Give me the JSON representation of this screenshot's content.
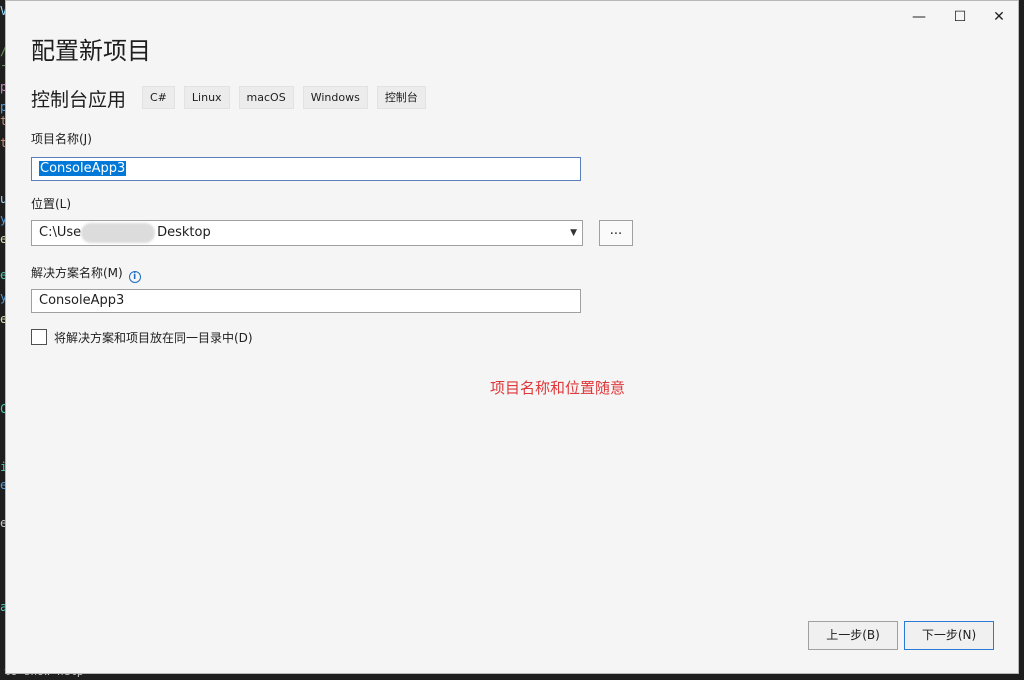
{
  "background": {
    "editor_glyphs": [
      "V",
      "/",
      "-",
      "p",
      "p",
      "t",
      "t",
      "u",
      "y",
      "e",
      "e",
      "y",
      "e",
      "C",
      "i",
      "e",
      "e",
      "a"
    ],
    "footer_text": "to show help"
  },
  "window": {
    "minimize_glyph": "—",
    "maximize_glyph": "☐",
    "close_glyph": "✕"
  },
  "dialog": {
    "title": "配置新项目",
    "template_name": "控制台应用",
    "tags": [
      "C#",
      "Linux",
      "macOS",
      "Windows",
      "控制台"
    ]
  },
  "project_name": {
    "label": "项目名称(J)",
    "value": "ConsoleApp3"
  },
  "location": {
    "label": "位置(L)",
    "value_prefix": "C:\\Use",
    "value_suffix": "Desktop",
    "browse_label": "..."
  },
  "solution_name": {
    "label": "解决方案名称(M)",
    "info_glyph": "i",
    "value": "ConsoleApp3"
  },
  "same_dir_checkbox": {
    "label": "将解决方案和项目放在同一目录中(D)",
    "checked": false
  },
  "annotation": {
    "text": "项目名称和位置随意",
    "color": "#e0383a"
  },
  "buttons": {
    "back_label": "上一步(B)",
    "next_label": "下一步(N)"
  },
  "colors": {
    "accent": "#0078d7",
    "dialog_bg": "#f5f5f5"
  }
}
